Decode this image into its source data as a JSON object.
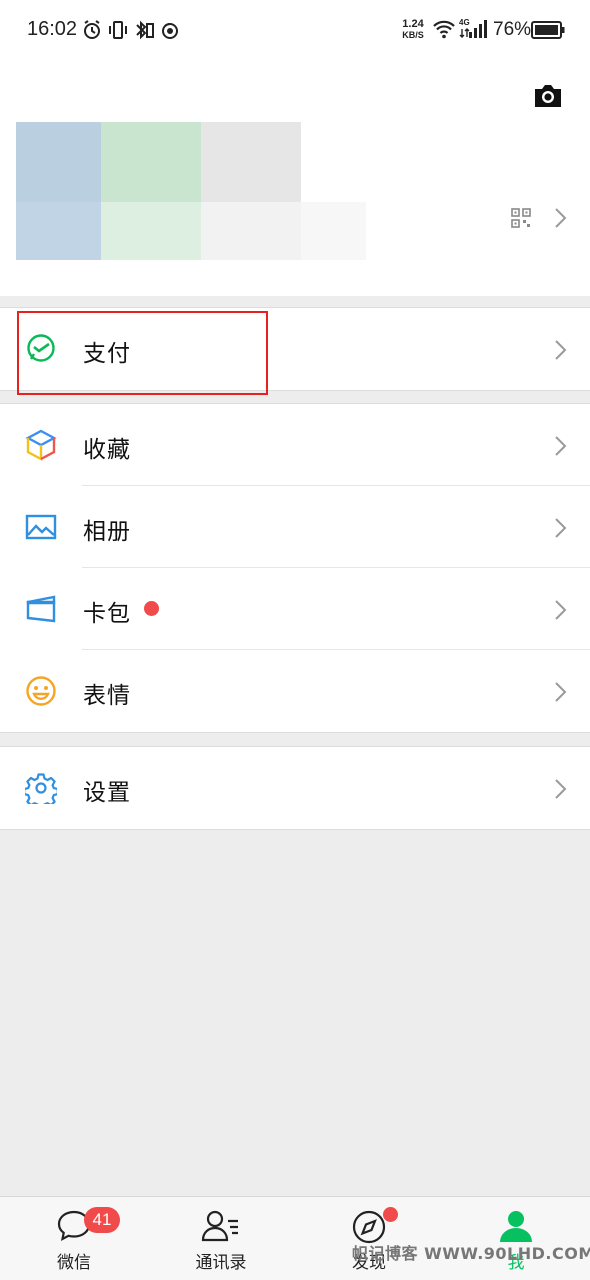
{
  "status_bar": {
    "time": "16:02",
    "net_speed_value": "1.24",
    "net_speed_unit": "KB/S",
    "network_type": "4G",
    "battery_percent": "76%"
  },
  "profile": {
    "camera_icon": "camera-icon",
    "qr_icon": "qr-code-icon"
  },
  "menu": {
    "pay_label": "支付",
    "favorites_label": "收藏",
    "album_label": "相册",
    "cards_label": "卡包",
    "stickers_label": "表情",
    "settings_label": "设置"
  },
  "colors": {
    "accent_green": "#07c160",
    "badge_red": "#f04a4a",
    "highlight_red": "#e82020"
  },
  "tabbar": {
    "chats_label": "微信",
    "chats_badge": "41",
    "contacts_label": "通讯录",
    "discover_label": "发现",
    "me_label": "我"
  },
  "watermark": "帜记博客 WWW.90LHD.COM"
}
